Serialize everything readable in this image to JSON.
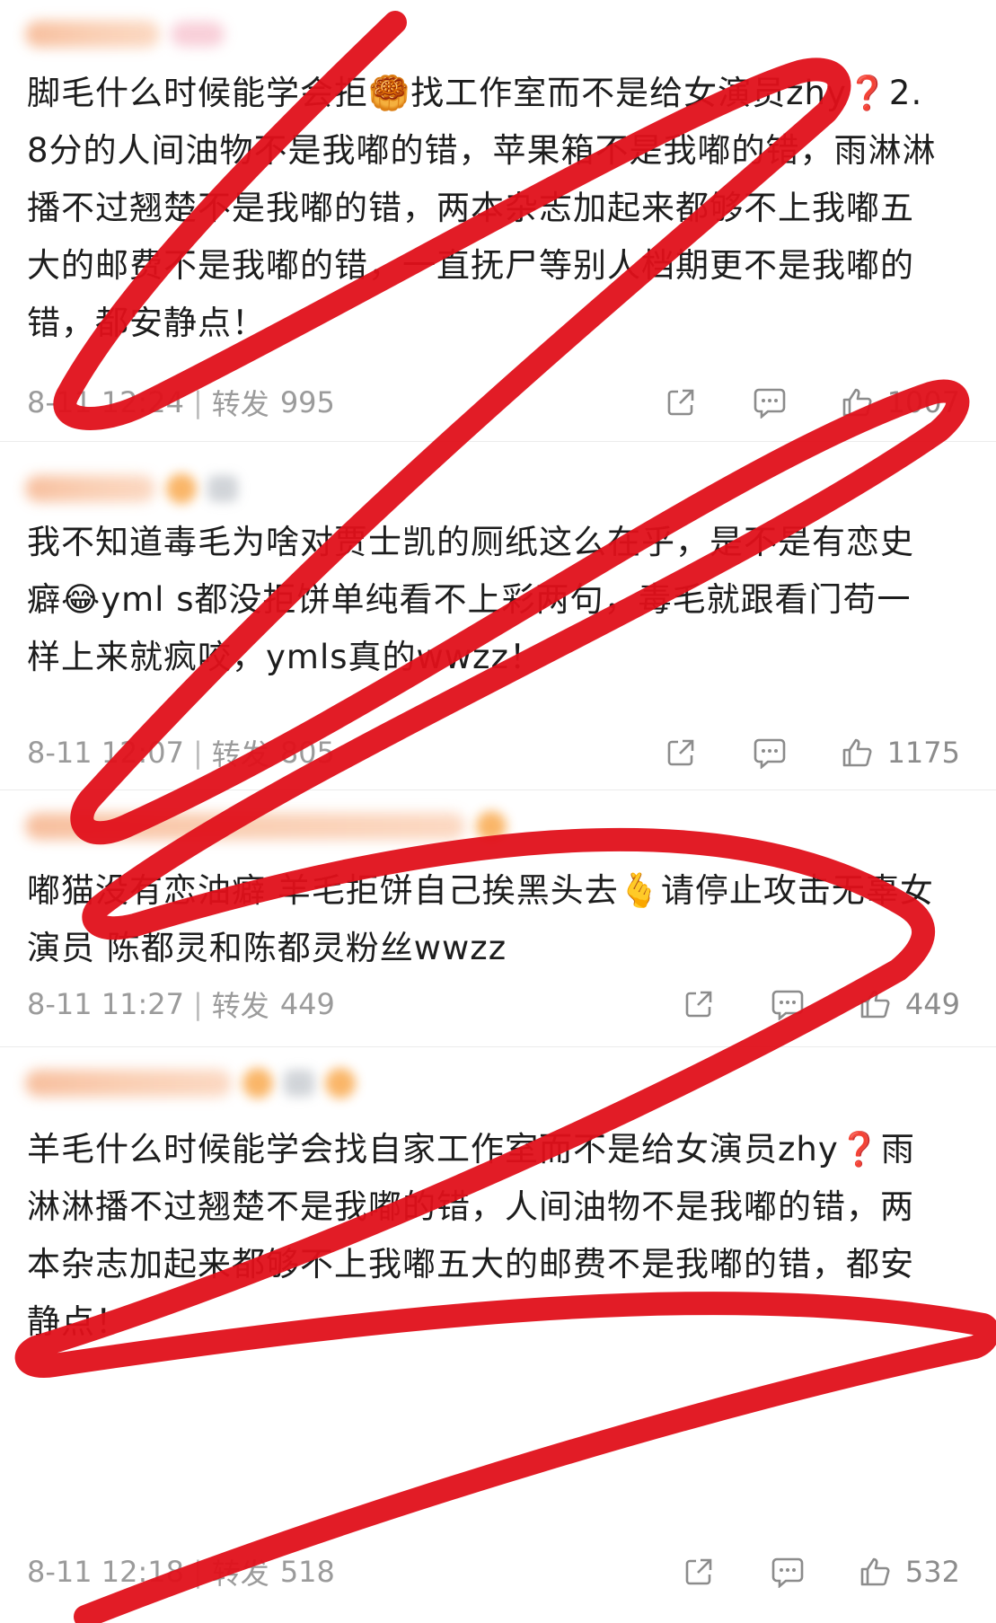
{
  "posts": [
    {
      "text": "脚毛什么时候能学会拒🥮找工作室而不是给女演员zhy❓2.8分的人间油物不是我嘟的错，苹果箱不是我嘟的错，雨淋淋播不过翘楚不是我嘟的错，两本杂志加起来都够不上我嘟五大的邮费不是我嘟的错，一直抚尸等别人档期更不是我嘟的错，都安静点！",
      "time": "8-11 12:24",
      "repost_label": "转发",
      "repost_count": "995",
      "like_count": "1007"
    },
    {
      "text": "我不知道毒毛为啥对贾士凯的厕纸这么在乎，是不是有恋史癖😂yml s都没拒饼单纯看不上彩两句，毒毛就跟看门苟一样上来就疯咬，ymls真的wwzz！",
      "time": "8-11 12:07",
      "repost_label": "转发",
      "repost_count": "805",
      "like_count": "1175"
    },
    {
      "text": "嘟猫没有恋油癖 羊毛拒饼自己挨黑头去🫰请停止攻击无辜女演员 陈都灵和陈都灵粉丝wwzz",
      "time": "8-11 11:27",
      "repost_label": "转发",
      "repost_count": "449",
      "like_count": "449"
    },
    {
      "text": "羊毛什么时候能学会找自家工作室而不是给女演员zhy❓雨淋淋播不过翘楚不是我嘟的错，人间油物不是我嘟的错，两本杂志加起来都够不上我嘟五大的邮费不是我嘟的错，都安静点！",
      "time": "8-11 12:18",
      "repost_label": "转发",
      "repost_count": "518",
      "like_count": "532"
    }
  ],
  "colors": {
    "scribble": "#e0101a",
    "meta_text": "#9b9b9b",
    "divider": "#ebebeb"
  },
  "icons": [
    "share-icon",
    "comment-icon",
    "like-icon"
  ]
}
